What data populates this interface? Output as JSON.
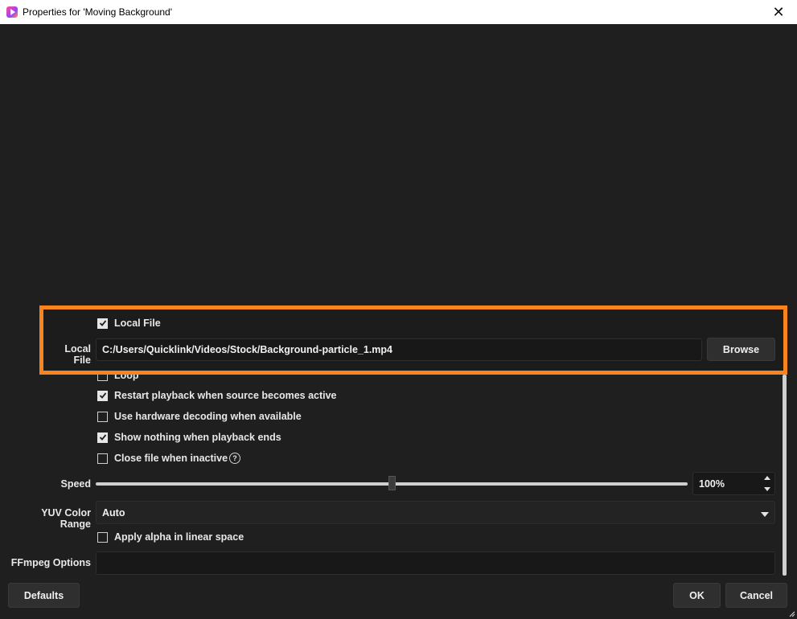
{
  "window": {
    "title": "Properties for 'Moving Background'"
  },
  "local_file_toggle": {
    "label": "Local File",
    "checked": true
  },
  "local_file": {
    "label": "Local File",
    "value": "C:/Users/Quicklink/Videos/Stock/Background-particle_1.mp4",
    "browse_label": "Browse"
  },
  "options": [
    {
      "label": "Loop",
      "checked": false
    },
    {
      "label": "Restart playback when source becomes active",
      "checked": true
    },
    {
      "label": "Use hardware decoding when available",
      "checked": false
    },
    {
      "label": "Show nothing when playback ends",
      "checked": true
    },
    {
      "label": "Close file when inactive",
      "checked": false,
      "help": "?"
    }
  ],
  "speed": {
    "label": "Speed",
    "value": "100%",
    "slider_fraction": 0.5
  },
  "yuv": {
    "label": "YUV Color Range",
    "value": "Auto"
  },
  "alpha": {
    "label": "Apply alpha in linear space",
    "checked": false
  },
  "ffmpeg": {
    "label": "FFmpeg Options",
    "value": ""
  },
  "footer": {
    "defaults_label": "Defaults",
    "ok_label": "OK",
    "cancel_label": "Cancel"
  },
  "colors": {
    "accent_highlight": "#f7841c",
    "background": "#1f1f1f"
  }
}
